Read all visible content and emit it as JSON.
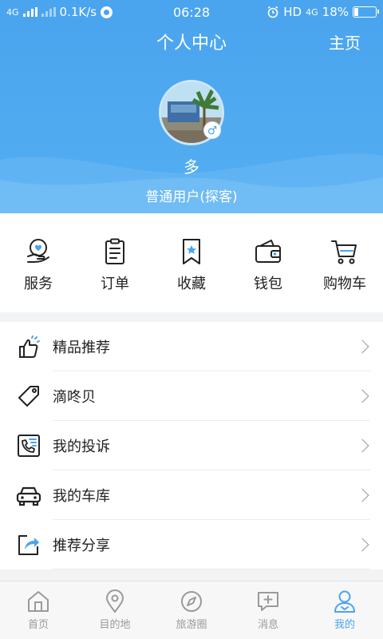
{
  "status_bar": {
    "network_left": "4G",
    "speed": "0.1K/s",
    "time": "06:28",
    "hd": "HD",
    "network_right": "4G",
    "battery": "18%"
  },
  "header": {
    "title": "个人中心",
    "home_link": "主页",
    "username": "多",
    "user_level": "普通用户(探客)",
    "gender_symbol": "♂"
  },
  "quick_actions": [
    {
      "label": "服务",
      "icon": "service-icon"
    },
    {
      "label": "订单",
      "icon": "order-icon"
    },
    {
      "label": "收藏",
      "icon": "bookmark-icon"
    },
    {
      "label": "钱包",
      "icon": "wallet-icon"
    },
    {
      "label": "购物车",
      "icon": "cart-icon"
    }
  ],
  "menu": [
    {
      "label": "精品推荐",
      "icon": "thumbs-up-icon"
    },
    {
      "label": "滴咚贝",
      "icon": "tag-icon"
    },
    {
      "label": "我的投诉",
      "icon": "complaint-phone-icon"
    },
    {
      "label": "我的车库",
      "icon": "car-icon"
    },
    {
      "label": "推荐分享",
      "icon": "share-icon"
    }
  ],
  "bottom_nav": [
    {
      "label": "首页",
      "icon": "home-icon",
      "active": false
    },
    {
      "label": "目的地",
      "icon": "location-pin-icon",
      "active": false
    },
    {
      "label": "旅游圈",
      "icon": "compass-icon",
      "active": false
    },
    {
      "label": "消息",
      "icon": "message-icon",
      "active": false
    },
    {
      "label": "我的",
      "icon": "user-icon",
      "active": true
    }
  ],
  "colors": {
    "accent": "#4aa4ee",
    "header_bg": "#54aef2",
    "icon_dark": "#222222",
    "icon_blue": "#4aa4ee"
  }
}
